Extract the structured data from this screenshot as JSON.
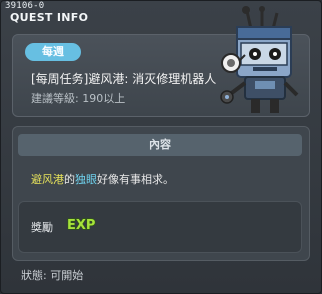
{
  "titlebar": {
    "quest_id": "39106-0",
    "title": "QUEST INFO"
  },
  "quest": {
    "badge": "每週",
    "name": "[每周任务]避风港: 消灭修理机器人",
    "level_requirement": "建議等級: 190以上"
  },
  "content": {
    "header": "內容",
    "desc_part1": "避风港",
    "desc_part2": "的",
    "desc_part3": "独眼",
    "desc_part4": "好像有事相求。"
  },
  "reward": {
    "label": "獎勵",
    "exp_text": "EXP"
  },
  "status": {
    "text": "狀態: 可開始"
  },
  "colors": {
    "badge": "#67bfe2",
    "highlight_yellow": "#e7e35b",
    "highlight_cyan": "#6fd3ef",
    "exp_green": "#a6e23b"
  }
}
